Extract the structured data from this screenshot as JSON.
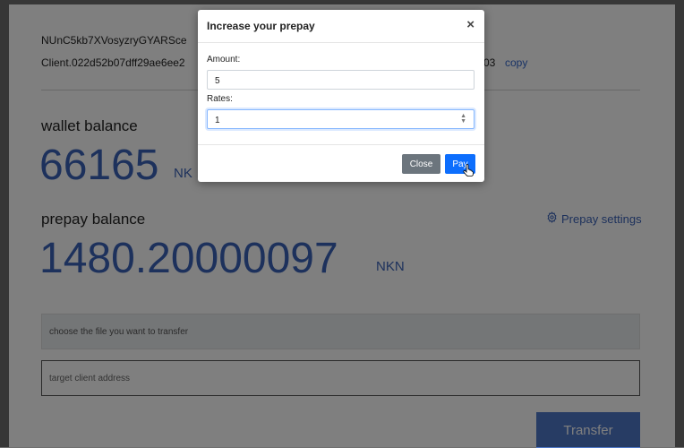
{
  "account": {
    "address_wallet": "NUnC5kb7XVosyzryGYARSce",
    "address_client": "Client.022d52b07dff29ae6ee2",
    "address_client_tail": "03",
    "copy_label": "copy"
  },
  "wallet": {
    "label": "wallet balance",
    "value": "66165",
    "unit": "NK"
  },
  "prepay": {
    "label": "prepay balance",
    "value": "1480.20000097",
    "unit": "NKN",
    "settings_label": "Prepay settings"
  },
  "transfer": {
    "file_placeholder": "choose the file you want to transfer",
    "target_placeholder": "target client address",
    "button_label": "Transfer"
  },
  "modal": {
    "title": "Increase your prepay",
    "close_symbol": "×",
    "amount_label": "Amount:",
    "amount_value": "5",
    "rates_label": "Rates:",
    "rates_value": "1",
    "close_label": "Close",
    "pay_label": "Pay"
  },
  "colors": {
    "accent": "#3b63b8",
    "primary_button": "#0d6efd",
    "secondary_button": "#6c757d"
  },
  "icons": {
    "settings": "gear-icon",
    "spinner": "spinner-arrows-icon",
    "cursor": "hand-pointer-icon"
  }
}
